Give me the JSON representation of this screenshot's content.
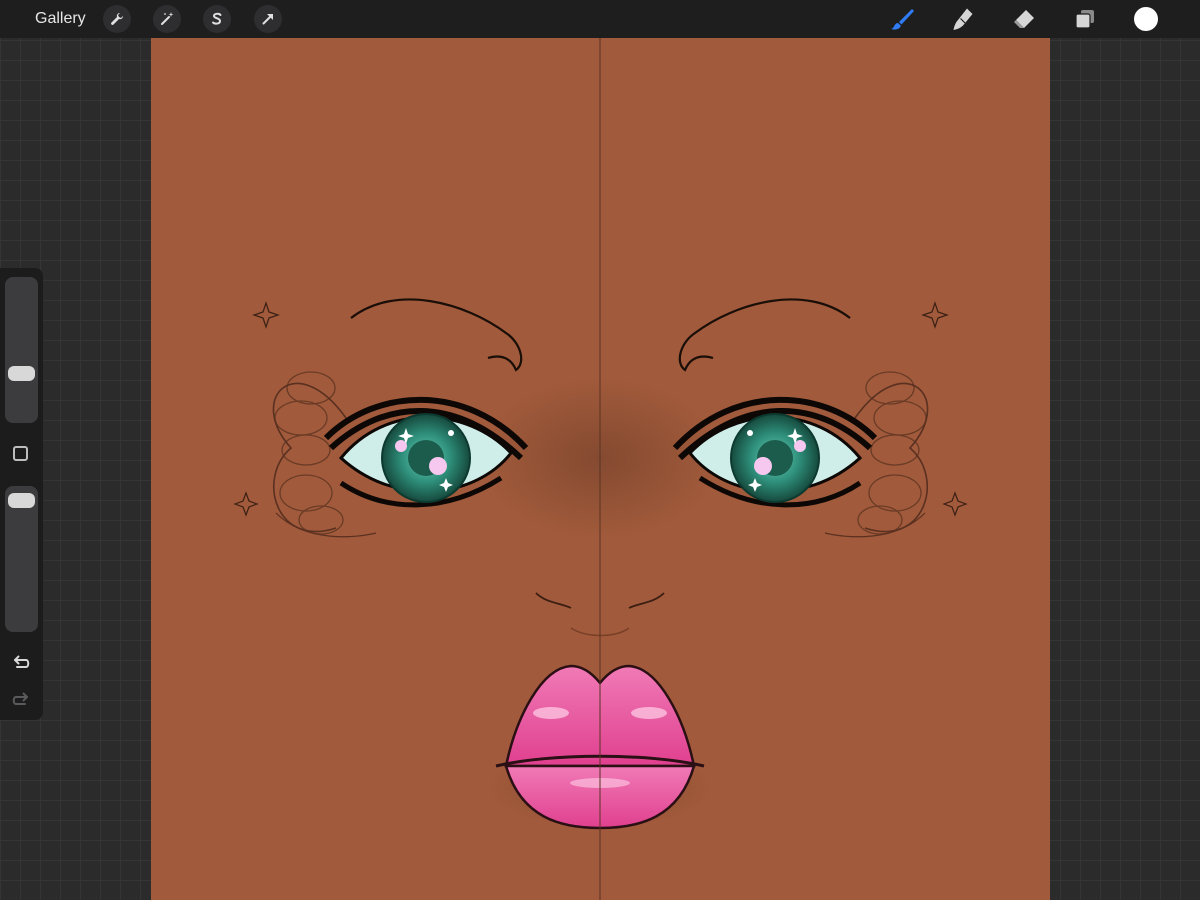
{
  "toolbar": {
    "gallery_label": "Gallery",
    "actions_icon": "wrench-icon",
    "adjustments_icon": "magic-wand-icon",
    "selection_icon": "selection-s-icon",
    "transform_icon": "arrow-cursor-icon",
    "brush_icon": "brush-icon",
    "smudge_icon": "smudge-icon",
    "eraser_icon": "eraser-icon",
    "layers_icon": "layers-icon",
    "current_color": "#ffffff",
    "active_tool_color": "#2f7cf6"
  },
  "sidebar": {
    "brush_size_level": 0.32,
    "opacity_level": 0.95,
    "modify_icon": "square-icon",
    "undo_icon": "undo-icon",
    "redo_icon": "redo-icon"
  },
  "canvas": {
    "skin_color": "#a15a3b",
    "iris_color": "#2e8f7a",
    "lip_color": "#ec4f9a",
    "symmetry_guide": "vertical"
  }
}
